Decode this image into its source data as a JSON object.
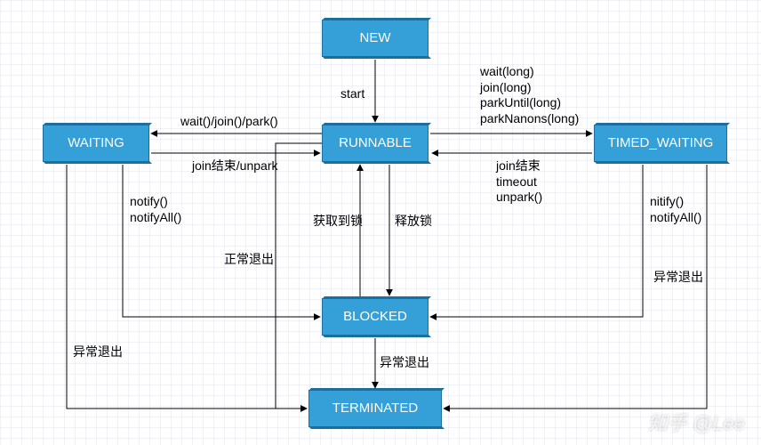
{
  "states": {
    "new": {
      "label": "NEW"
    },
    "runnable": {
      "label": "RUNNABLE"
    },
    "waiting": {
      "label": "WAITING"
    },
    "timed_waiting": {
      "label": "TIMED_WAITING"
    },
    "blocked": {
      "label": "BLOCKED"
    },
    "terminated": {
      "label": "TERMINATED"
    }
  },
  "edges": {
    "new_to_runnable": {
      "label": "start"
    },
    "runnable_to_waiting": {
      "label": "wait()/join()/park()"
    },
    "waiting_to_runnable": {
      "label": "join结束/unpark"
    },
    "runnable_to_timed_waiting": {
      "label": "wait(long)\njoin(long)\nparkUntil(long)\nparkNanons(long)"
    },
    "timed_waiting_to_runnable": {
      "label": "join结束\ntimeout\nunpark()"
    },
    "waiting_to_blocked": {
      "label": "notify()\nnotifyAll()"
    },
    "timed_waiting_to_blocked": {
      "label": "nitify()\nnotifyAll()"
    },
    "runnable_to_blocked": {
      "label": "释放锁"
    },
    "blocked_to_runnable": {
      "label": "获取到锁"
    },
    "runnable_to_terminated": {
      "label": "正常退出"
    },
    "blocked_to_terminated": {
      "label": "异常退出"
    },
    "waiting_to_terminated": {
      "label": "异常退出"
    },
    "timed_waiting_to_terminated": {
      "label": "异常退出"
    }
  },
  "watermark": "知乎 @Lee"
}
